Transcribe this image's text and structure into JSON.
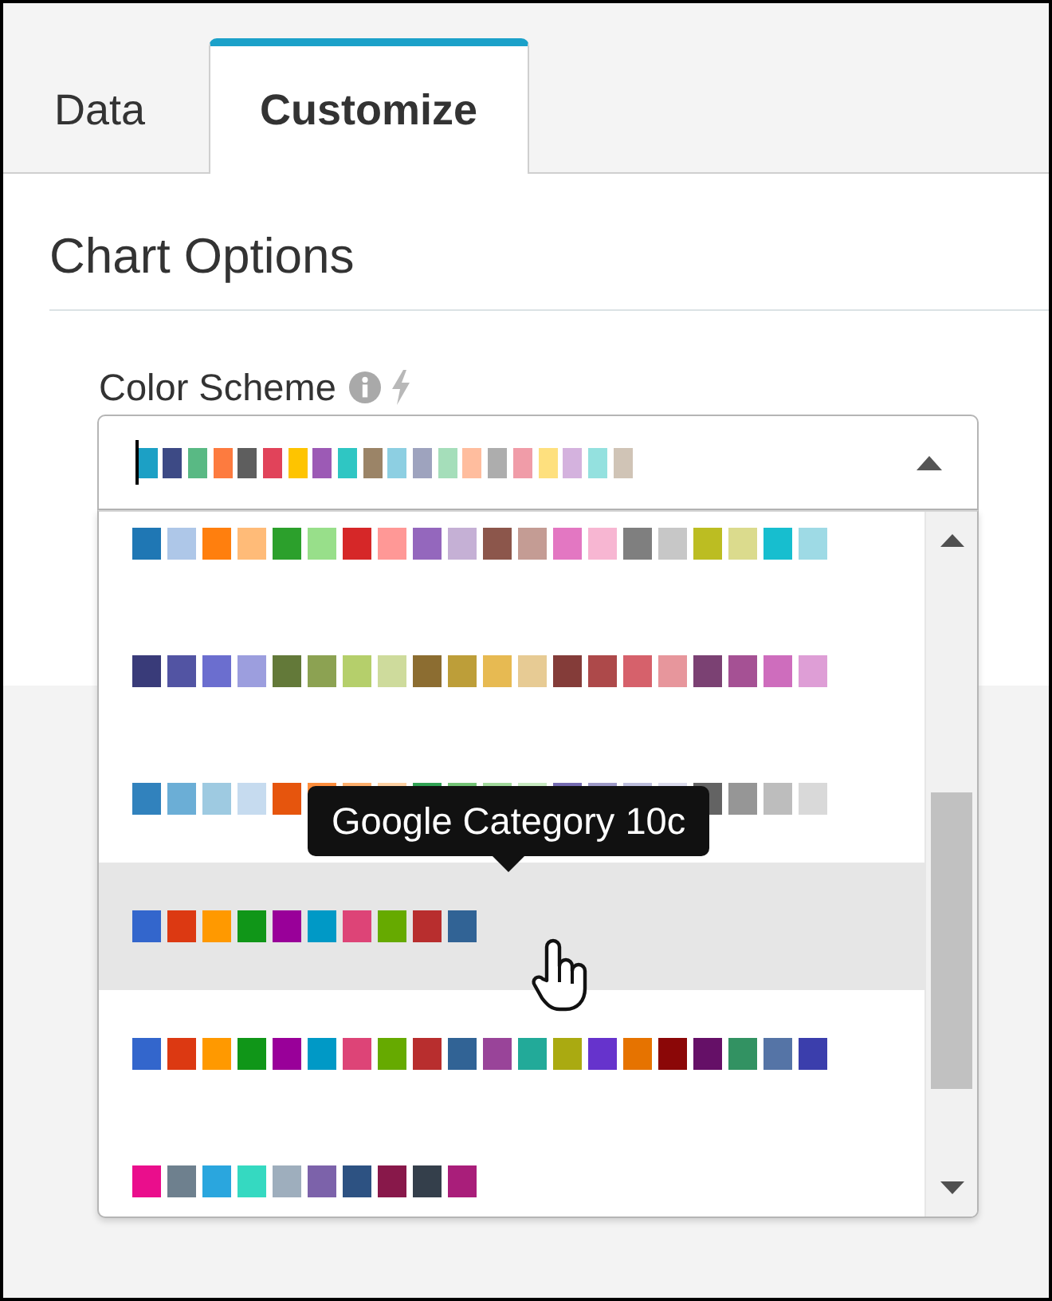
{
  "tabs": [
    {
      "label": "Data",
      "selected": false
    },
    {
      "label": "Customize",
      "selected": true
    }
  ],
  "section_title": "Chart Options",
  "color_scheme": {
    "label": "Color Scheme",
    "expanded": true,
    "focused": true,
    "value": [
      {
        "color": "#1ca0c5"
      },
      {
        "color": "#3d4a85"
      },
      {
        "color": "#59b984"
      },
      {
        "color": "#fd7b3f"
      },
      {
        "color": "#5e5e5e"
      },
      {
        "color": "#e1435a"
      },
      {
        "color": "#fec400"
      },
      {
        "color": "#9c5ab5"
      },
      {
        "color": "#2fc6c3"
      },
      {
        "color": "#9b8467"
      },
      {
        "color": "#8dcfe2"
      },
      {
        "color": "#9ea3be"
      },
      {
        "color": "#a5deba"
      },
      {
        "color": "#ffbd9e"
      },
      {
        "color": "#adadad"
      },
      {
        "color": "#f09ca8"
      },
      {
        "color": "#fee07e"
      },
      {
        "color": "#d4b2de"
      },
      {
        "color": "#94e1df"
      },
      {
        "color": "#d0c4b6"
      }
    ],
    "options": [
      {
        "selected": false,
        "hovered": false,
        "swatches": [
          {
            "color": "#1f77b4"
          },
          {
            "color": "#aec7e8"
          },
          {
            "color": "#ff7f0e"
          },
          {
            "color": "#ffbb78"
          },
          {
            "color": "#2ca02c"
          },
          {
            "color": "#98df8a"
          },
          {
            "color": "#d62728"
          },
          {
            "color": "#ff9896"
          },
          {
            "color": "#9467bd"
          },
          {
            "color": "#c5b0d5"
          },
          {
            "color": "#8c564b"
          },
          {
            "color": "#c49c94"
          },
          {
            "color": "#e377c2"
          },
          {
            "color": "#f7b6d2"
          },
          {
            "color": "#7f7f7f"
          },
          {
            "color": "#c7c7c7"
          },
          {
            "color": "#bcbd22"
          },
          {
            "color": "#dbdb8d"
          },
          {
            "color": "#17becf"
          },
          {
            "color": "#9edae5"
          }
        ]
      },
      {
        "selected": false,
        "hovered": false,
        "swatches": [
          {
            "color": "#393b79"
          },
          {
            "color": "#5254a3"
          },
          {
            "color": "#6b6ecf"
          },
          {
            "color": "#9c9ede"
          },
          {
            "color": "#637939"
          },
          {
            "color": "#8ca252"
          },
          {
            "color": "#b5cf6b"
          },
          {
            "color": "#cedb9c"
          },
          {
            "color": "#8c6d31"
          },
          {
            "color": "#bd9e39"
          },
          {
            "color": "#e7ba52"
          },
          {
            "color": "#e7cb94"
          },
          {
            "color": "#843c39"
          },
          {
            "color": "#ad494a"
          },
          {
            "color": "#d6616b"
          },
          {
            "color": "#e7969c"
          },
          {
            "color": "#7b4173"
          },
          {
            "color": "#a55194"
          },
          {
            "color": "#ce6dbd"
          },
          {
            "color": "#de9ed6"
          }
        ]
      },
      {
        "selected": false,
        "hovered": false,
        "swatches": [
          {
            "color": "#3182bd"
          },
          {
            "color": "#6baed6"
          },
          {
            "color": "#9ecae1"
          },
          {
            "color": "#c6dbef"
          },
          {
            "color": "#e6550d"
          },
          {
            "color": "#fd8d3c"
          },
          {
            "color": "#fdae6b"
          },
          {
            "color": "#fdd0a2"
          },
          {
            "color": "#31a354"
          },
          {
            "color": "#74c476"
          },
          {
            "color": "#a1d99b"
          },
          {
            "color": "#c7e9c0"
          },
          {
            "color": "#756bb1"
          },
          {
            "color": "#9e9ac8"
          },
          {
            "color": "#bcbddc"
          },
          {
            "color": "#dadaeb"
          },
          {
            "color": "#636363"
          },
          {
            "color": "#969696"
          },
          {
            "color": "#bdbdbd"
          },
          {
            "color": "#d9d9d9"
          }
        ]
      },
      {
        "selected": false,
        "hovered": true,
        "swatches": [
          {
            "color": "#3366cc"
          },
          {
            "color": "#dc3912"
          },
          {
            "color": "#ff9900"
          },
          {
            "color": "#109618"
          },
          {
            "color": "#990099"
          },
          {
            "color": "#0099c6"
          },
          {
            "color": "#dd4477"
          },
          {
            "color": "#66aa00"
          },
          {
            "color": "#b82e2e"
          },
          {
            "color": "#316395"
          }
        ]
      },
      {
        "selected": false,
        "hovered": false,
        "swatches": [
          {
            "color": "#3366cc"
          },
          {
            "color": "#dc3912"
          },
          {
            "color": "#ff9900"
          },
          {
            "color": "#109618"
          },
          {
            "color": "#990099"
          },
          {
            "color": "#0099c6"
          },
          {
            "color": "#dd4477"
          },
          {
            "color": "#66aa00"
          },
          {
            "color": "#b82e2e"
          },
          {
            "color": "#316395"
          },
          {
            "color": "#994499"
          },
          {
            "color": "#22aa99"
          },
          {
            "color": "#aaaa11"
          },
          {
            "color": "#6633cc"
          },
          {
            "color": "#e67300"
          },
          {
            "color": "#8b0707"
          },
          {
            "color": "#651067"
          },
          {
            "color": "#329262"
          },
          {
            "color": "#5574a6"
          },
          {
            "color": "#3b3eac"
          }
        ]
      },
      {
        "selected": false,
        "hovered": false,
        "swatches": [
          {
            "color": "#ea0e8c"
          },
          {
            "color": "#6e808e"
          },
          {
            "color": "#2aa6de"
          },
          {
            "color": "#35d9c1"
          },
          {
            "color": "#9eaebd"
          },
          {
            "color": "#7c62aa"
          },
          {
            "color": "#2d5282"
          },
          {
            "color": "#88184a"
          },
          {
            "color": "#343f4b"
          },
          {
            "color": "#a91e7a"
          }
        ]
      }
    ],
    "tooltip": "Google Category 10c"
  }
}
